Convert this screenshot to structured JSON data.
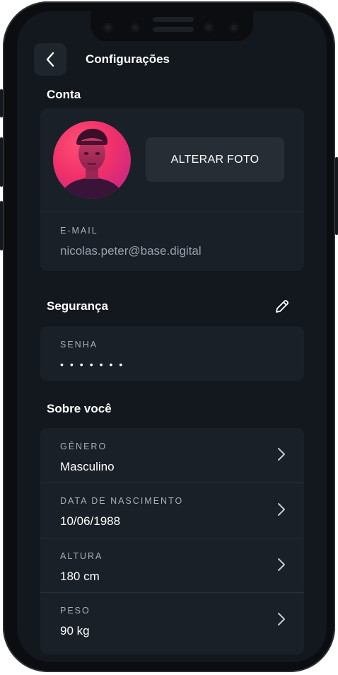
{
  "header": {
    "title": "Configurações",
    "back_icon": "chevron-left-icon"
  },
  "account": {
    "section_title": "Conta",
    "change_photo_label": "ALTERAR FOTO",
    "email_label": "E-MAIL",
    "email_value": "nicolas.peter@base.digital"
  },
  "security": {
    "section_title": "Segurança",
    "edit_icon": "pencil-icon",
    "password_label": "SENHA",
    "password_value": "•••••••"
  },
  "about": {
    "section_title": "Sobre você",
    "fields": [
      {
        "label": "GÊNERO",
        "value": "Masculino"
      },
      {
        "label": "DATA DE NASCIMENTO",
        "value": "10/06/1988"
      },
      {
        "label": "ALTURA",
        "value": "180 cm"
      },
      {
        "label": "PESO",
        "value": "90 kg"
      }
    ]
  },
  "colors": {
    "background": "#13181e",
    "card": "#1a2027",
    "avatar_gradient_start": "#ff4f74",
    "avatar_gradient_end": "#b8248f"
  }
}
